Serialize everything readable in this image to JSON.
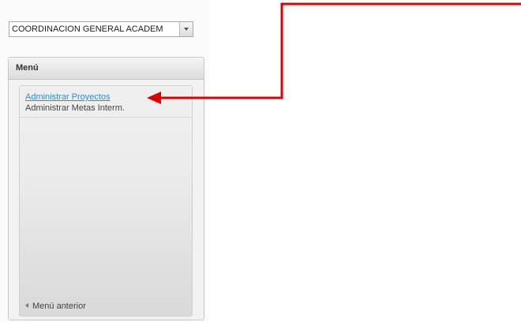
{
  "department_select": {
    "value": "COORDINACION GENERAL ACADEM"
  },
  "menu": {
    "title": "Menú",
    "items": [
      {
        "label": "Administrar Proyectos",
        "is_link": true
      },
      {
        "label": "Administrar Metas Interm.",
        "is_link": false
      }
    ],
    "back_label": "Menú anterior"
  },
  "colors": {
    "annotation": "#e00000",
    "link": "#2a8fd0"
  },
  "icons": [
    "chevron-down-icon",
    "chevron-left-icon",
    "red-arrow-annotation"
  ]
}
